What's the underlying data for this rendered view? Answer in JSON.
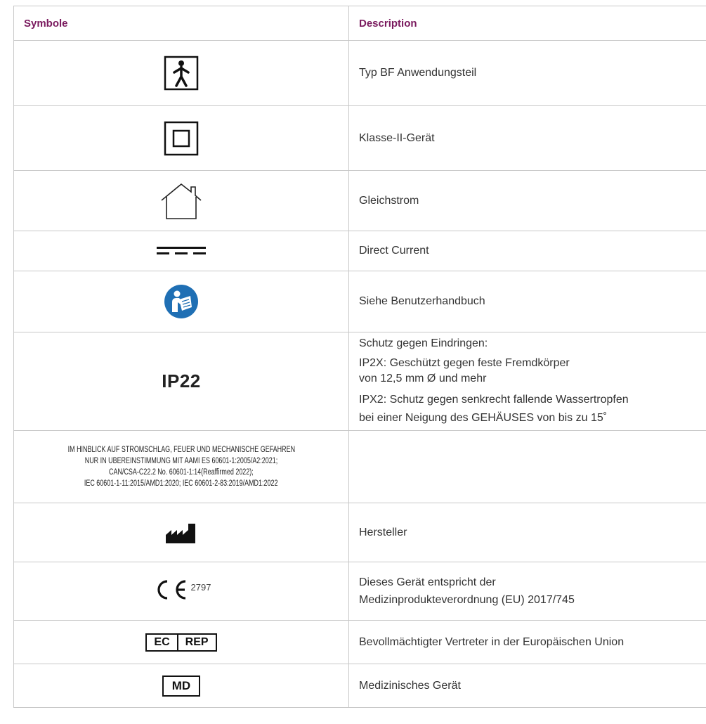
{
  "header": {
    "symbol_col": "Symbole",
    "description_col": "Description"
  },
  "rows": [
    {
      "icon": "type-bf-applied-part-icon",
      "description": "Typ BF Anwendungsteil"
    },
    {
      "icon": "class-ii-device-icon",
      "description": "Klasse-II-Gerät"
    },
    {
      "icon": "indoor-use-house-icon",
      "description": "Gleichstrom"
    },
    {
      "icon": "direct-current-icon",
      "description": "Direct Current"
    },
    {
      "icon": "consult-user-manual-icon",
      "description": "Siehe Benutzerhandbuch"
    },
    {
      "symbol_text": "IP22",
      "description_lines": [
        "Schutz gegen Eindringen:",
        "IP2X: Geschützt gegen feste Fremdkörper",
        "von 12,5 mm Ø und mehr",
        "IPX2: Schutz gegen senkrecht fallende Wassertropfen",
        "bei einer Neigung des GEHÄUSES von bis zu 15˚"
      ]
    },
    {
      "symbol_lines": [
        "IM HINBLICK AUF STROMSCHLAG, FEUER UND MECHANISCHE GEFAHREN",
        "NUR IN ÜBEREINSTIMMUNG MIT AAMI ES 60601-1:2005/A2:2021;",
        "CAN/CSA-C22.2 No. 60601-1:14(Reaffirmed 2022);",
        "IEC 60601-1-11:2015/AMD1:2020; IEC 60601-2-83:2019/AMD1:2022"
      ],
      "description": ""
    },
    {
      "icon": "manufacturer-icon",
      "description": "Hersteller"
    },
    {
      "icon": "ce-mark-icon",
      "symbol_number": "2797",
      "description_lines": [
        "Dieses Gerät entspricht der",
        "Medizinprodukteverordnung (EU) 2017/745"
      ]
    },
    {
      "symbol_parts": [
        "EC",
        "REP"
      ],
      "description": "Bevollmächtigter Vertreter in der Europäischen Union"
    },
    {
      "symbol_text": "MD",
      "description": "Medizinisches Gerät"
    }
  ]
}
